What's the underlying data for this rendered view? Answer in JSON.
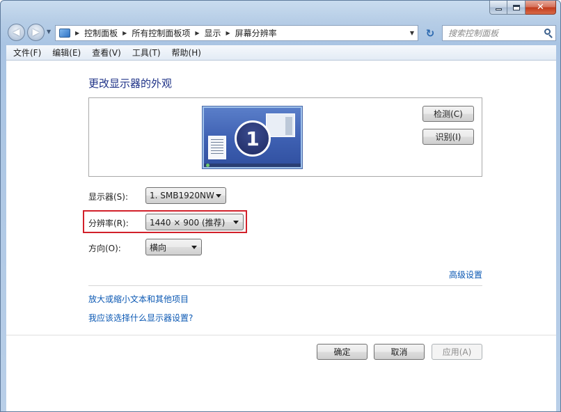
{
  "window": {
    "caption": {
      "minimize_icon": "minimize-icon",
      "maximize_icon": "maximize-icon",
      "close_icon": "close-icon",
      "close_glyph": "✕"
    }
  },
  "nav": {
    "back_glyph": "◀",
    "forward_glyph": "▶",
    "breadcrumb": [
      "控制面板",
      "所有控制面板项",
      "显示",
      "屏幕分辨率"
    ],
    "search_placeholder": "搜索控制面板",
    "refresh_glyph": "↻"
  },
  "menubar": {
    "items": [
      "文件(F)",
      "编辑(E)",
      "查看(V)",
      "工具(T)",
      "帮助(H)"
    ]
  },
  "content": {
    "heading": "更改显示器的外观",
    "monitor_number": "1",
    "detect_button": "检测(C)",
    "identify_button": "识别(I)",
    "display_label": "显示器(S):",
    "display_value": "1. SMB1920NW",
    "resolution_label": "分辨率(R):",
    "resolution_value": "1440 × 900 (推荐)",
    "orientation_label": "方向(O):",
    "orientation_value": "横向",
    "advanced_link": "高级设置",
    "text_size_link": "放大或缩小文本和其他项目",
    "help_link": "我应该选择什么显示器设置?"
  },
  "footer": {
    "ok_button": "确定",
    "cancel_button": "取消",
    "apply_button": "应用(A)"
  },
  "colors": {
    "highlight_border": "#d2202a",
    "link": "#0b58b3",
    "heading": "#1e3287"
  }
}
